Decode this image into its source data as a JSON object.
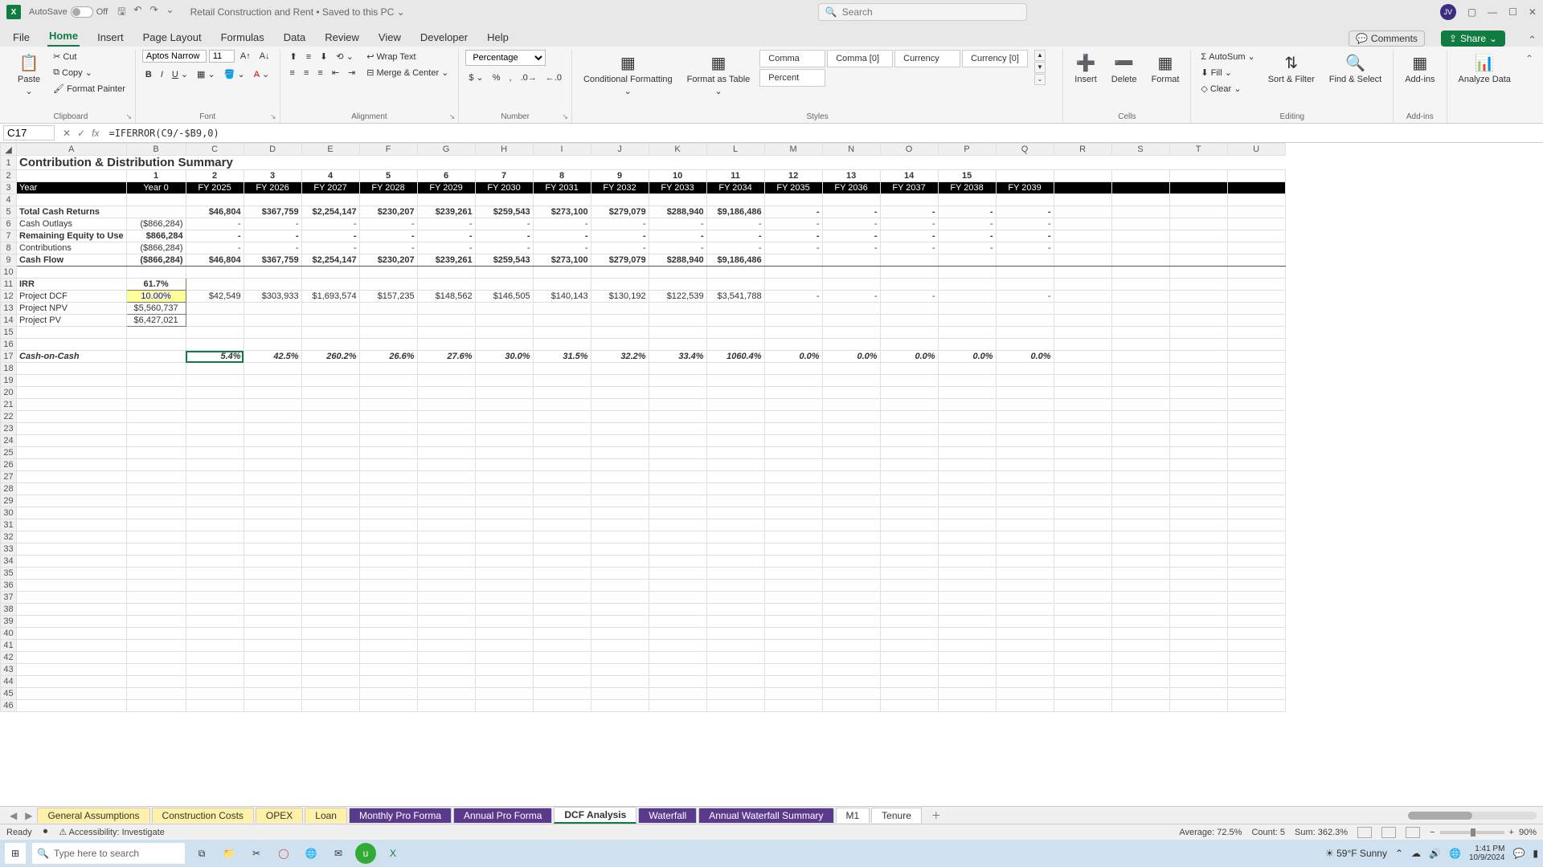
{
  "title": {
    "autosave": "AutoSave",
    "autosave_state": "Off",
    "docname": "Retail Construction and Rent",
    "saved": "• Saved to this PC ⌄",
    "search_ph": "Search"
  },
  "menu": {
    "tabs": [
      "File",
      "Home",
      "Insert",
      "Page Layout",
      "Formulas",
      "Data",
      "Review",
      "View",
      "Developer",
      "Help"
    ],
    "active": "Home",
    "comments": "Comments",
    "share": "Share"
  },
  "ribbon": {
    "clipboard": {
      "paste": "Paste",
      "cut": "Cut",
      "copy": "Copy",
      "fp": "Format Painter",
      "label": "Clipboard"
    },
    "font": {
      "name": "Aptos Narrow",
      "size": "11",
      "label": "Font"
    },
    "align": {
      "wrap": "Wrap Text",
      "merge": "Merge & Center",
      "label": "Alignment"
    },
    "number": {
      "fmt": "Percentage",
      "label": "Number"
    },
    "styles": {
      "cf": "Conditional Formatting",
      "fat": "Format as Table",
      "s1": "Comma",
      "s2": "Comma [0]",
      "s3": "Currency",
      "s4": "Currency [0]",
      "s5": "Percent",
      "label": "Styles"
    },
    "cells": {
      "ins": "Insert",
      "del": "Delete",
      "fmt": "Format",
      "label": "Cells"
    },
    "editing": {
      "sum": "AutoSum",
      "fill": "Fill",
      "clear": "Clear",
      "sort": "Sort & Filter",
      "find": "Find & Select",
      "label": "Editing"
    },
    "addins": {
      "btn": "Add-ins",
      "label": "Add-ins"
    },
    "analyze": {
      "btn": "Analyze Data"
    }
  },
  "fbar": {
    "cell": "C17",
    "formula": "=IFERROR(C9/-$B9,0)"
  },
  "cols": [
    "A",
    "B",
    "C",
    "D",
    "E",
    "F",
    "G",
    "H",
    "I",
    "J",
    "K",
    "L",
    "M",
    "N",
    "O",
    "P",
    "Q",
    "R",
    "S",
    "T",
    "U"
  ],
  "sheet": {
    "title": "Contribution & Distribution Summary",
    "periods": [
      "",
      "1",
      "2",
      "3",
      "4",
      "5",
      "6",
      "7",
      "8",
      "9",
      "10",
      "11",
      "12",
      "13",
      "14",
      "15"
    ],
    "years": [
      "Year",
      "Year 0",
      "FY 2025",
      "FY 2026",
      "FY 2027",
      "FY 2028",
      "FY 2029",
      "FY 2030",
      "FY 2031",
      "FY 2032",
      "FY 2033",
      "FY 2034",
      "FY 2035",
      "FY 2036",
      "FY 2037",
      "FY 2038",
      "FY 2039"
    ],
    "rows": [
      {
        "n": "5",
        "label": "Total Cash Returns",
        "bold": true,
        "vals": [
          "",
          "$46,804",
          "$367,759",
          "$2,254,147",
          "$230,207",
          "$239,261",
          "$259,543",
          "$273,100",
          "$279,079",
          "$288,940",
          "$9,186,486",
          "-",
          "-",
          "-",
          "-",
          "-"
        ]
      },
      {
        "n": "6",
        "label": "Cash Outlays",
        "vals": [
          "($866,284)",
          "-",
          "-",
          "-",
          "-",
          "-",
          "-",
          "-",
          "-",
          "-",
          "-",
          "-",
          "-",
          "-",
          "-",
          "-"
        ]
      },
      {
        "n": "7",
        "label": "Remaining Equity to Use",
        "bold": true,
        "vals": [
          "$866,284",
          "-",
          "-",
          "-",
          "-",
          "-",
          "-",
          "-",
          "-",
          "-",
          "-",
          "-",
          "-",
          "-",
          "-",
          "-"
        ]
      },
      {
        "n": "8",
        "label": "Contributions",
        "vals": [
          "($866,284)",
          "-",
          "-",
          "-",
          "-",
          "-",
          "-",
          "-",
          "-",
          "-",
          "-",
          "-",
          "-",
          "-",
          "-",
          "-"
        ]
      },
      {
        "n": "9",
        "label": "Cash Flow",
        "bold": true,
        "bt": true,
        "bb": true,
        "vals": [
          "($866,284)",
          "$46,804",
          "$367,759",
          "$2,254,147",
          "$230,207",
          "$239,261",
          "$259,543",
          "$273,100",
          "$279,079",
          "$288,940",
          "$9,186,486",
          "",
          "",
          "",
          "",
          ""
        ]
      }
    ],
    "irr": {
      "label": "IRR",
      "val": "61.7%"
    },
    "dcf": {
      "label": "Project DCF",
      "rate": "10.00%",
      "vals": [
        "$42,549",
        "$303,933",
        "$1,693,574",
        "$157,235",
        "$148,562",
        "$146,505",
        "$140,143",
        "$130,192",
        "$122,539",
        "$3,541,788",
        "-",
        "-",
        "-",
        "",
        "-"
      ]
    },
    "npv": {
      "label": "Project NPV",
      "val": "$5,560,737"
    },
    "pv": {
      "label": "Project PV",
      "val": "$6,427,021"
    },
    "coc": {
      "label": "Cash-on-Cash",
      "vals": [
        "",
        "5.4%",
        "42.5%",
        "260.2%",
        "26.6%",
        "27.6%",
        "30.0%",
        "31.5%",
        "32.2%",
        "33.4%",
        "1060.4%",
        "0.0%",
        "0.0%",
        "0.0%",
        "0.0%",
        "0.0%"
      ]
    }
  },
  "tabs": [
    {
      "label": "General Assumptions",
      "cls": "yellow"
    },
    {
      "label": "Construction Costs",
      "cls": "yellow"
    },
    {
      "label": "OPEX",
      "cls": "yellow"
    },
    {
      "label": "Loan",
      "cls": "yellow"
    },
    {
      "label": "Monthly Pro Forma",
      "cls": "purple"
    },
    {
      "label": "Annual Pro Forma",
      "cls": "purple"
    },
    {
      "label": "DCF Analysis",
      "cls": "active"
    },
    {
      "label": "Waterfall",
      "cls": "purple"
    },
    {
      "label": "Annual Waterfall Summary",
      "cls": "purple"
    },
    {
      "label": "M1",
      "cls": ""
    },
    {
      "label": "Tenure",
      "cls": ""
    }
  ],
  "status": {
    "ready": "Ready",
    "acc": "Accessibility: Investigate",
    "avg": "Average: 72.5%",
    "cnt": "Count: 5",
    "sum": "Sum: 362.3%",
    "zoom": "90%"
  },
  "taskbar": {
    "search": "Type here to search",
    "weather": "59°F  Sunny",
    "time": "1:41 PM",
    "date": "10/9/2024"
  },
  "chart_data": {
    "type": "table",
    "title": "Contribution & Distribution Summary",
    "columns": [
      "Year 0",
      "FY 2025",
      "FY 2026",
      "FY 2027",
      "FY 2028",
      "FY 2029",
      "FY 2030",
      "FY 2031",
      "FY 2032",
      "FY 2033",
      "FY 2034",
      "FY 2035",
      "FY 2036",
      "FY 2037",
      "FY 2038",
      "FY 2039"
    ],
    "series": [
      {
        "name": "Total Cash Returns",
        "values": [
          null,
          46804,
          367759,
          2254147,
          230207,
          239261,
          259543,
          273100,
          279079,
          288940,
          9186486,
          null,
          null,
          null,
          null,
          null
        ]
      },
      {
        "name": "Cash Outlays",
        "values": [
          -866284,
          null,
          null,
          null,
          null,
          null,
          null,
          null,
          null,
          null,
          null,
          null,
          null,
          null,
          null,
          null
        ]
      },
      {
        "name": "Remaining Equity to Use",
        "values": [
          866284,
          null,
          null,
          null,
          null,
          null,
          null,
          null,
          null,
          null,
          null,
          null,
          null,
          null,
          null,
          null
        ]
      },
      {
        "name": "Contributions",
        "values": [
          -866284,
          null,
          null,
          null,
          null,
          null,
          null,
          null,
          null,
          null,
          null,
          null,
          null,
          null,
          null,
          null
        ]
      },
      {
        "name": "Cash Flow",
        "values": [
          -866284,
          46804,
          367759,
          2254147,
          230207,
          239261,
          259543,
          273100,
          279079,
          288940,
          9186486,
          null,
          null,
          null,
          null,
          null
        ]
      },
      {
        "name": "Project DCF",
        "values": [
          null,
          42549,
          303933,
          1693574,
          157235,
          148562,
          146505,
          140143,
          130192,
          122539,
          3541788,
          null,
          null,
          null,
          null,
          null
        ]
      },
      {
        "name": "Cash-on-Cash",
        "values": [
          null,
          5.4,
          42.5,
          260.2,
          26.6,
          27.6,
          30.0,
          31.5,
          32.2,
          33.4,
          1060.4,
          0.0,
          0.0,
          0.0,
          0.0,
          0.0
        ]
      }
    ],
    "scalars": {
      "IRR": 61.7,
      "DCF Rate": 10.0,
      "Project NPV": 5560737,
      "Project PV": 6427021
    }
  }
}
